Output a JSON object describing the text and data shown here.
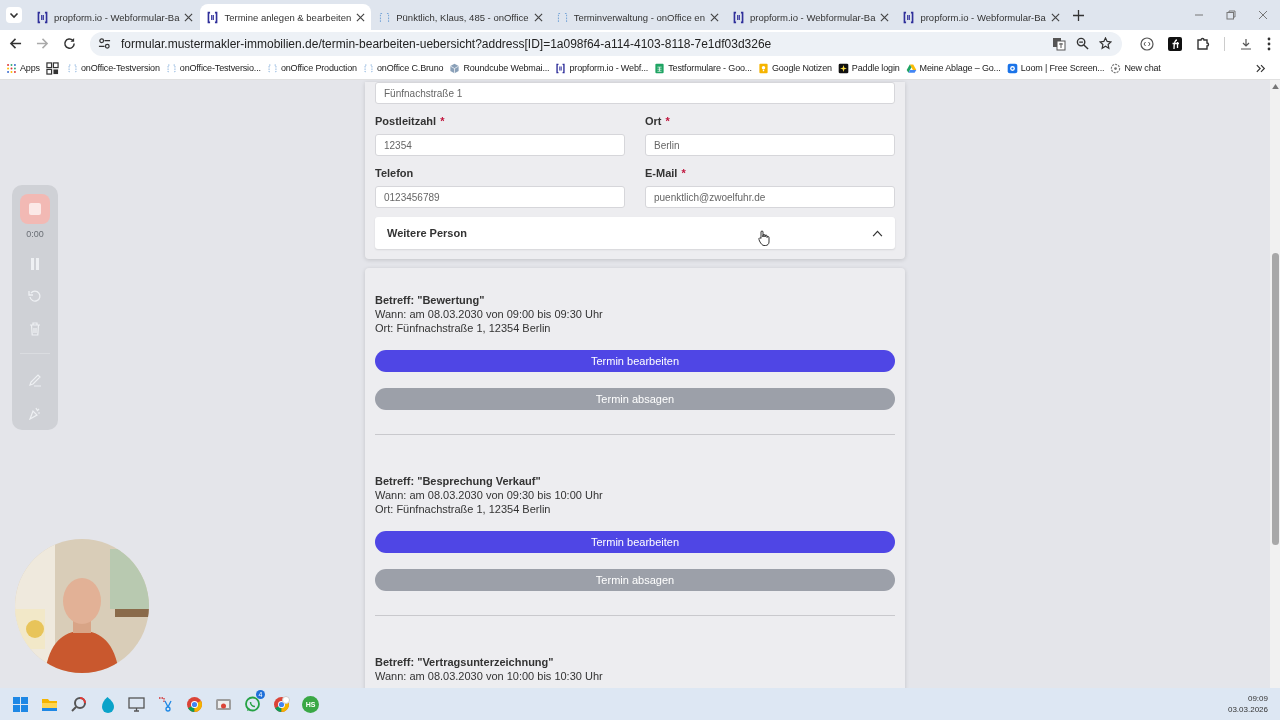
{
  "browser": {
    "tabs": [
      {
        "title": "propform.io - Webformular-Ba",
        "kind": "propform",
        "selected": false
      },
      {
        "title": "Termine anlegen & bearbeiten",
        "kind": "propform",
        "selected": true
      },
      {
        "title": "Pünktlich, Klaus, 485 - onOffice",
        "kind": "dashed",
        "selected": false
      },
      {
        "title": "Terminverwaltung - onOffice en",
        "kind": "dashed",
        "selected": false
      },
      {
        "title": "propform.io - Webformular-Ba",
        "kind": "propform",
        "selected": false
      },
      {
        "title": "propform.io - Webformular-Ba",
        "kind": "propform",
        "selected": false
      }
    ],
    "address": "formular.mustermakler-immobilien.de/termin-bearbeiten-uebersicht?address[ID]=1a098f64-a114-4103-8118-7e1df03d326e",
    "bookmarks": [
      {
        "label": "Apps",
        "kind": "apps"
      },
      {
        "label": "onOffice-Testversion",
        "kind": "dashed"
      },
      {
        "label": "onOffice-Testversio...",
        "kind": "dashed"
      },
      {
        "label": "onOffice Production",
        "kind": "dashed"
      },
      {
        "label": "onOffice C.Bruno",
        "kind": "dashed"
      },
      {
        "label": "Roundcube Webmai...",
        "kind": "cube"
      },
      {
        "label": "propform.io - Webf...",
        "kind": "propform"
      },
      {
        "label": "Testformulare - Goo...",
        "kind": "sheet"
      },
      {
        "label": "Google Notizen",
        "kind": "keep"
      },
      {
        "label": "Paddle login",
        "kind": "paddle"
      },
      {
        "label": "Meine Ablage – Go...",
        "kind": "drive"
      },
      {
        "label": "Loom | Free Screen...",
        "kind": "loom"
      },
      {
        "label": "New chat",
        "kind": "chat"
      }
    ]
  },
  "form": {
    "street": {
      "value": "Fünfnachstraße 1"
    },
    "fields": [
      {
        "label": "Postleitzahl",
        "required": true,
        "value": "12354"
      },
      {
        "label": "Ort",
        "required": true,
        "value": "Berlin"
      },
      {
        "label": "Telefon",
        "required": false,
        "value": "0123456789"
      },
      {
        "label": "E-Mail",
        "required": true,
        "value": "puenktlich@zwoelfuhr.de"
      }
    ],
    "required_mark": "*",
    "accordion": {
      "title": "Weitere Person",
      "expanded": true
    }
  },
  "appointments": [
    {
      "subject": "Betreff: \"Bewertung\"",
      "when": "Wann: am 08.03.2030 von 09:00 bis 09:30 Uhr",
      "place": "Ort: Fünfnachstraße 1, 12354 Berlin",
      "edit_button": "Termin bearbeiten",
      "cancel_button": "Termin absagen"
    },
    {
      "subject": "Betreff: \"Besprechung Verkauf\"",
      "when": "Wann: am 08.03.2030 von 09:30 bis 10:00 Uhr",
      "place": "Ort: Fünfnachstraße 1, 12354 Berlin",
      "edit_button": "Termin bearbeiten",
      "cancel_button": "Termin absagen"
    },
    {
      "subject": "Betreff: \"Vertragsunterzeichnung\"",
      "when": "Wann: am 08.03.2030 von 10:00 bis 10:30 Uhr"
    }
  ],
  "recorder": {
    "time": "0:00"
  },
  "taskbar": {
    "apps": [
      {
        "kind": "windows"
      },
      {
        "kind": "folder"
      },
      {
        "kind": "magnifier"
      },
      {
        "kind": "drop"
      },
      {
        "kind": "monitor"
      },
      {
        "kind": "snip"
      },
      {
        "kind": "chrome"
      },
      {
        "kind": "remote"
      },
      {
        "kind": "whatsapp",
        "badge": "4"
      },
      {
        "kind": "chrome-profile"
      },
      {
        "kind": "hs",
        "label": "HS"
      }
    ],
    "time": "09:09",
    "date": "03.03.2026"
  }
}
